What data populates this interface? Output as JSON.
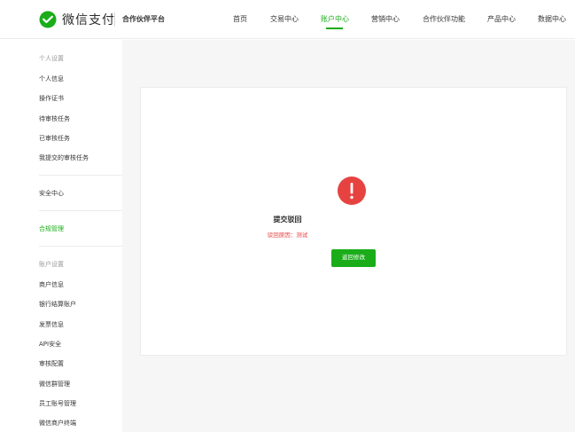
{
  "header": {
    "brand": "微信支付",
    "platform": "合作伙伴平台",
    "nav": [
      {
        "label": "首页",
        "active": false
      },
      {
        "label": "交易中心",
        "active": false
      },
      {
        "label": "账户中心",
        "active": true
      },
      {
        "label": "营销中心",
        "active": false
      },
      {
        "label": "合作伙伴功能",
        "active": false
      },
      {
        "label": "产品中心",
        "active": false
      },
      {
        "label": "数据中心",
        "active": false
      }
    ]
  },
  "sidebar": {
    "personal_section": "个人设置",
    "personal_items": [
      "个人信息",
      "操作证书",
      "待审核任务",
      "已审核任务",
      "我提交的审核任务"
    ],
    "security": "安全中心",
    "compliance": "合规管理",
    "account_section": "账户设置",
    "account_items": [
      "商户信息",
      "银行结算账户",
      "发票信息",
      "API安全",
      "审核配置",
      "微信群管理",
      "员工账号管理",
      "微信商户终端"
    ]
  },
  "result": {
    "title": "提交驳回",
    "reason": "驳回原因：测试",
    "button": "返回修改"
  },
  "colors": {
    "brand_green": "#1aad19",
    "error_red": "#e64340"
  },
  "icons": {
    "logo": "wechat-pay-logo",
    "status": "exclamation-circle-icon"
  }
}
